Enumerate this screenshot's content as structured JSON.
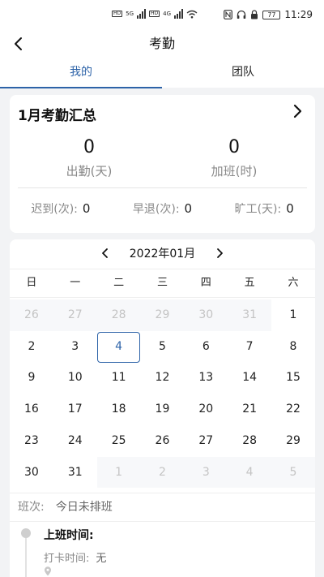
{
  "status_bar": {
    "time": "11:29",
    "battery": "77",
    "net_badge_1": "HD",
    "net_badge_2": "HD",
    "net_gen_1": "5G",
    "net_gen_2": "4G"
  },
  "app_bar": {
    "title": "考勤"
  },
  "tabs": [
    {
      "label": "我的",
      "active": true
    },
    {
      "label": "团队",
      "active": false
    }
  ],
  "summary": {
    "title": "1月考勤汇总",
    "attendance": {
      "value": "0",
      "label": "出勤(天)"
    },
    "overtime": {
      "value": "0",
      "label": "加班(时)"
    },
    "late": {
      "label": "迟到(次):",
      "value": "0"
    },
    "early_leave": {
      "label": "早退(次):",
      "value": "0"
    },
    "absent": {
      "label": "旷工(天):",
      "value": "0"
    }
  },
  "calendar": {
    "month_label": "2022年01月",
    "weekdays": [
      "日",
      "一",
      "二",
      "三",
      "四",
      "五",
      "六"
    ],
    "weeks": [
      [
        {
          "d": "26",
          "out": true
        },
        {
          "d": "27",
          "out": true
        },
        {
          "d": "28",
          "out": true
        },
        {
          "d": "29",
          "out": true
        },
        {
          "d": "30",
          "out": true
        },
        {
          "d": "31",
          "out": true
        },
        {
          "d": "1",
          "out": false
        }
      ],
      [
        {
          "d": "2",
          "out": false
        },
        {
          "d": "3",
          "out": false
        },
        {
          "d": "4",
          "out": false,
          "selected": true
        },
        {
          "d": "5",
          "out": false
        },
        {
          "d": "6",
          "out": false
        },
        {
          "d": "7",
          "out": false
        },
        {
          "d": "8",
          "out": false
        }
      ],
      [
        {
          "d": "9",
          "out": false
        },
        {
          "d": "10",
          "out": false
        },
        {
          "d": "11",
          "out": false
        },
        {
          "d": "12",
          "out": false
        },
        {
          "d": "13",
          "out": false
        },
        {
          "d": "14",
          "out": false
        },
        {
          "d": "15",
          "out": false
        }
      ],
      [
        {
          "d": "16",
          "out": false
        },
        {
          "d": "17",
          "out": false
        },
        {
          "d": "18",
          "out": false
        },
        {
          "d": "19",
          "out": false
        },
        {
          "d": "20",
          "out": false
        },
        {
          "d": "21",
          "out": false
        },
        {
          "d": "22",
          "out": false
        }
      ],
      [
        {
          "d": "23",
          "out": false
        },
        {
          "d": "24",
          "out": false
        },
        {
          "d": "25",
          "out": false
        },
        {
          "d": "26",
          "out": false
        },
        {
          "d": "27",
          "out": false
        },
        {
          "d": "28",
          "out": false
        },
        {
          "d": "29",
          "out": false
        }
      ],
      [
        {
          "d": "30",
          "out": false
        },
        {
          "d": "31",
          "out": false
        },
        {
          "d": "1",
          "out": true
        },
        {
          "d": "2",
          "out": true
        },
        {
          "d": "3",
          "out": true
        },
        {
          "d": "4",
          "out": true
        },
        {
          "d": "5",
          "out": true
        }
      ]
    ]
  },
  "shift": {
    "label": "班次:",
    "value": "今日未排班"
  },
  "timeline": {
    "title": "上班时间:",
    "punch_label": "打卡时间:",
    "punch_value": "无"
  },
  "colors": {
    "accent": "#2d63a8",
    "muted_text": "#888888",
    "out_of_month": "#c4c4c4"
  }
}
